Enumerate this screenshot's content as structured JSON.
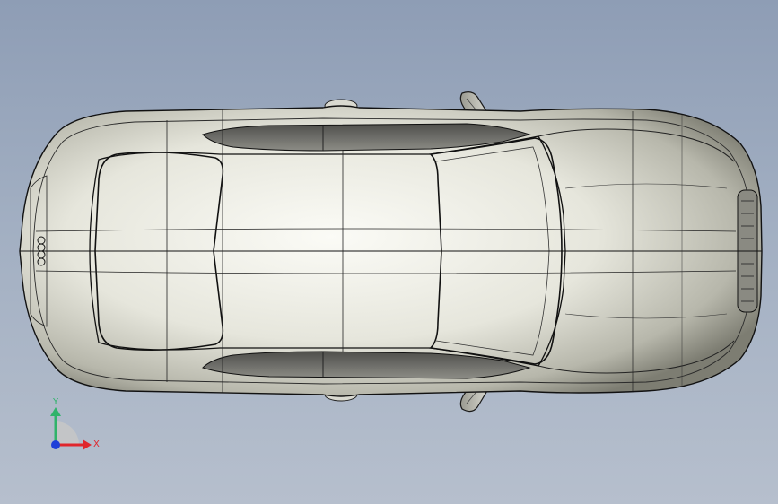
{
  "viewport": {
    "model": "car-body-top-view",
    "background_colors": [
      "#8e9db5",
      "#b6bfcd"
    ]
  },
  "model_colors": {
    "body_fill": "#e9e9e0",
    "edge": "#1a1a1a",
    "glass": "#6f6f6a"
  },
  "triad": {
    "y_label": "Y",
    "x_label": "X",
    "y_color": "#2fb36a",
    "x_color": "#e0262c",
    "z_color": "#1f3fd8"
  }
}
